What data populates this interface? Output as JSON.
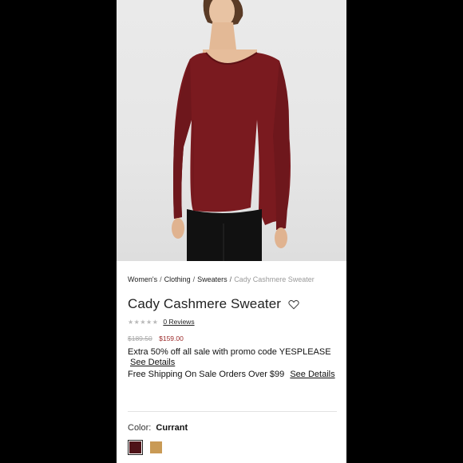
{
  "breadcrumb": {
    "items": [
      "Women's",
      "Clothing",
      "Sweaters"
    ],
    "separator": "/",
    "current": "Cady Cashmere Sweater"
  },
  "product": {
    "title": "Cady Cashmere Sweater",
    "rating_stars": "★★★★★",
    "reviews_label": "0 Reviews",
    "original_price": "$189.50",
    "sale_price": "$159.00",
    "promo_text": "Extra 50% off all sale with promo code YESPLEASE",
    "promo_link": "See Details",
    "shipping_text": "Free Shipping On Sale Orders Over $99",
    "shipping_link": "See Details"
  },
  "color": {
    "label": "Color:",
    "selected": "Currant",
    "swatches": [
      {
        "name": "Currant",
        "hex": "#4e1218",
        "selected": true
      },
      {
        "name": "Camel",
        "hex": "#c99a55",
        "selected": false
      }
    ]
  },
  "colors": {
    "sweater": "#7a1a1f",
    "sale_price": "#9b2a2a",
    "background": "#000000"
  }
}
